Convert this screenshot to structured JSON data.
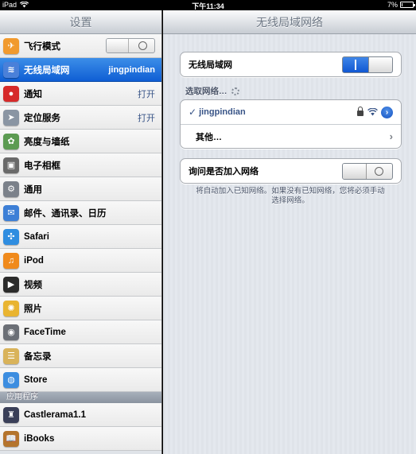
{
  "status_bar": {
    "device": "iPad",
    "time": "下午11:34",
    "battery": "7%",
    "battery_level": 0.07
  },
  "master": {
    "title": "设置",
    "items": [
      {
        "id": "airplane",
        "label": "飞行模式",
        "icon": "airplane-icon",
        "color": "#f19a2e",
        "glyph": "✈",
        "switch": "off"
      },
      {
        "id": "wifi",
        "label": "无线局域网",
        "value": "jingpindian",
        "icon": "wifi-icon",
        "color": "#4a80d9",
        "glyph": "≋",
        "selected": true
      },
      {
        "id": "notifications",
        "label": "通知",
        "value": "打开",
        "icon": "notifications-icon",
        "color": "#d62a2a",
        "glyph": "●"
      },
      {
        "id": "location",
        "label": "定位服务",
        "value": "打开",
        "icon": "location-icon",
        "color": "#8a95a3",
        "glyph": "➤"
      },
      {
        "id": "brightness",
        "label": "亮度与墙纸",
        "icon": "brightness-icon",
        "color": "#5c9b52",
        "glyph": "✿"
      },
      {
        "id": "frame",
        "label": "电子相框",
        "icon": "picture-frame-icon",
        "color": "#6a6a6a",
        "glyph": "▣"
      },
      {
        "id": "general",
        "label": "通用",
        "icon": "gear-icon",
        "color": "#7b818a",
        "glyph": "⚙"
      },
      {
        "id": "mail",
        "label": "邮件、通讯录、日历",
        "icon": "mail-icon",
        "color": "#3d7fd6",
        "glyph": "✉"
      },
      {
        "id": "safari",
        "label": "Safari",
        "icon": "safari-icon",
        "color": "#2f8de0",
        "glyph": "✣"
      },
      {
        "id": "ipod",
        "label": "iPod",
        "icon": "ipod-icon",
        "color": "#f08a1c",
        "glyph": "♫"
      },
      {
        "id": "video",
        "label": "视频",
        "icon": "video-icon",
        "color": "#2b2b2b",
        "glyph": "▶"
      },
      {
        "id": "photos",
        "label": "照片",
        "icon": "photos-icon",
        "color": "#e9b430",
        "glyph": "✺"
      },
      {
        "id": "facetime",
        "label": "FaceTime",
        "icon": "facetime-icon",
        "color": "#6b6f76",
        "glyph": "◉"
      },
      {
        "id": "notes",
        "label": "备忘录",
        "icon": "notes-icon",
        "color": "#d9b35a",
        "glyph": "☰"
      },
      {
        "id": "store",
        "label": "Store",
        "icon": "store-icon",
        "color": "#3c8de0",
        "glyph": "◍"
      }
    ],
    "apps_header": "应用程序",
    "apps": [
      {
        "id": "castlerama",
        "label": "Castlerama1.1",
        "icon": "castlerama-icon",
        "color": "#3a3f58",
        "glyph": "♜"
      },
      {
        "id": "ibooks",
        "label": "iBooks",
        "icon": "ibooks-icon",
        "color": "#b4742c",
        "glyph": "📖"
      }
    ]
  },
  "detail": {
    "title": "无线局域网络",
    "wifi_row": {
      "label": "无线局域网",
      "switch": "on"
    },
    "choose_network": "选取网络…",
    "networks": [
      {
        "name": "jingpindian",
        "selected": true,
        "locked": true
      }
    ],
    "other": "其他…",
    "ask_row": {
      "label": "询问是否加入网络",
      "switch": "off"
    },
    "footer_note": "将自动加入已知网络。如果没有已知网络，您将必须手动选择网络。"
  }
}
